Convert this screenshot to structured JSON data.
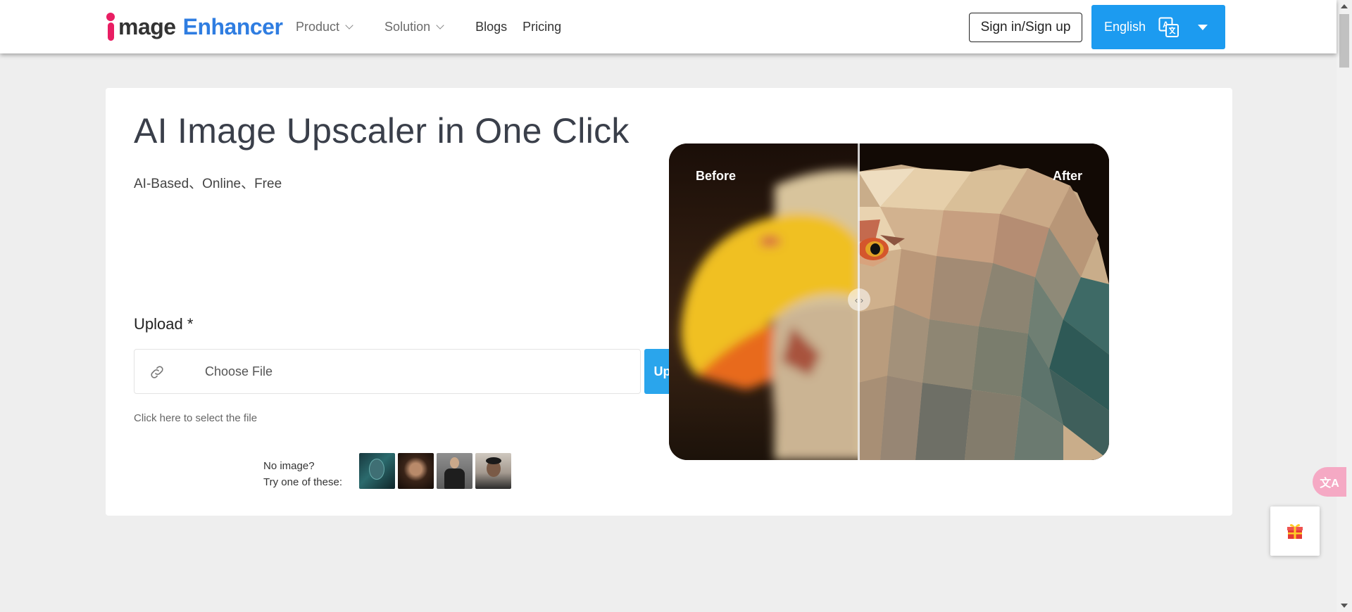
{
  "header": {
    "logo": {
      "part1": "mage",
      "part2": "Enhancer"
    },
    "nav": [
      {
        "label": "Product",
        "dropdown": true
      },
      {
        "label": "Solution",
        "dropdown": true
      },
      {
        "label": "Blogs",
        "dropdown": false
      },
      {
        "label": "Pricing",
        "dropdown": false
      }
    ],
    "signin_label": "Sign in/Sign up",
    "language_label": "English"
  },
  "hero": {
    "title": "AI Image Upscaler in One Click",
    "subtitle": "AI-Based、Online、Free",
    "upload_label": "Upload *",
    "choose_placeholder": "Choose File",
    "upload_button": "Upload Image",
    "hint": "Click here to select the file",
    "try_line1": "No image?",
    "try_line2": "Try one of these:"
  },
  "compare": {
    "before_label": "Before",
    "after_label": "After"
  },
  "floating": {
    "translate_glyph": "文A"
  },
  "colors": {
    "accent": "#2aa5ec",
    "language_button": "#1c9bf0",
    "logo_pink": "#e91e63",
    "logo_blue": "#2f7de1"
  },
  "icons": [
    "chevron-down-icon",
    "translate-icon",
    "caret-down-icon",
    "link-icon",
    "arrows-horizontal-icon",
    "gift-icon",
    "scroll-up-icon",
    "scroll-down-icon"
  ]
}
